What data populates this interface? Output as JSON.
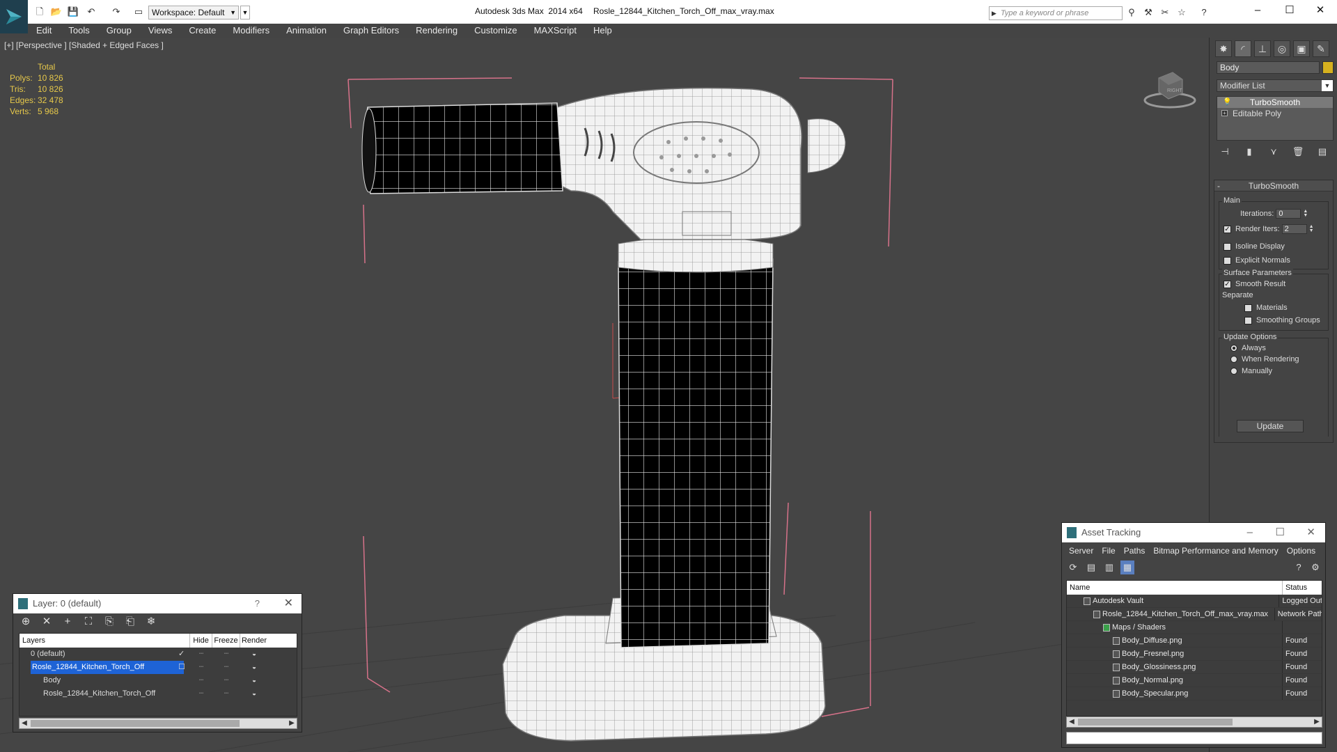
{
  "titlebar": {
    "app_title": "Autodesk 3ds Max  2014 x64",
    "file_title": "Rosle_12844_Kitchen_Torch_Off_max_vray.max",
    "workspace": "Workspace: Default",
    "search_placeholder": "Type a keyword or phrase"
  },
  "menu": [
    "Edit",
    "Tools",
    "Group",
    "Views",
    "Create",
    "Modifiers",
    "Animation",
    "Graph Editors",
    "Rendering",
    "Customize",
    "MAXScript",
    "Help"
  ],
  "viewport": {
    "label": "[+] [Perspective ] [Shaded + Edged Faces ]",
    "stats": {
      "header": "Total",
      "rows": [
        {
          "label": "Polys:",
          "value": "10 826"
        },
        {
          "label": "Tris:",
          "value": "10 826"
        },
        {
          "label": "Edges:",
          "value": "32 478"
        },
        {
          "label": "Verts:",
          "value": "5 968"
        }
      ]
    },
    "viewcube_label": "RIGHT"
  },
  "command_panel": {
    "object_name": "Body",
    "object_color": "#d6b11f",
    "modifier_list": "Modifier List",
    "stack": [
      {
        "label": "TurboSmooth",
        "selected": true
      },
      {
        "label": "Editable Poly",
        "selected": false
      }
    ],
    "rollout_title": "TurboSmooth",
    "main_group": "Main",
    "iterations_label": "Iterations:",
    "iterations_value": "0",
    "render_iters_label": "Render Iters:",
    "render_iters_value": "2",
    "render_iters_checked": true,
    "isoline_label": "Isoline Display",
    "explicit_normals_label": "Explicit Normals",
    "surface_group": "Surface Parameters",
    "smooth_result_label": "Smooth Result",
    "separate_label": "Separate",
    "materials_label": "Materials",
    "smoothing_groups_label": "Smoothing Groups",
    "update_group": "Update Options",
    "always_label": "Always",
    "when_rendering_label": "When Rendering",
    "manually_label": "Manually",
    "update_button": "Update"
  },
  "layer_explorer": {
    "title": "Layer: 0 (default)",
    "help": "?",
    "columns": [
      "Layers",
      "Hide",
      "Freeze",
      "Render"
    ],
    "rows": [
      {
        "name": "0 (default)",
        "indent": 1,
        "selected": false,
        "active": true
      },
      {
        "name": "Rosle_12844_Kitchen_Torch_Off",
        "indent": 1,
        "selected": true,
        "active": false
      },
      {
        "name": "Body",
        "indent": 2,
        "selected": false,
        "active": false
      },
      {
        "name": "Rosle_12844_Kitchen_Torch_Off",
        "indent": 2,
        "selected": false,
        "active": false
      }
    ]
  },
  "asset_tracking": {
    "title": "Asset Tracking",
    "menu": [
      "Server",
      "File",
      "Paths",
      "Bitmap Performance and Memory",
      "Options"
    ],
    "columns": [
      "Name",
      "Status"
    ],
    "rows": [
      {
        "name": "Autodesk Vault",
        "indent": 1,
        "status": "Logged Out"
      },
      {
        "name": "Rosle_12844_Kitchen_Torch_Off_max_vray.max",
        "indent": 2,
        "status": "Network Path"
      },
      {
        "name": "Maps / Shaders",
        "indent": 3,
        "status": ""
      },
      {
        "name": "Body_Diffuse.png",
        "indent": 4,
        "status": "Found"
      },
      {
        "name": "Body_Fresnel.png",
        "indent": 4,
        "status": "Found"
      },
      {
        "name": "Body_Glossiness.png",
        "indent": 4,
        "status": "Found"
      },
      {
        "name": "Body_Normal.png",
        "indent": 4,
        "status": "Found"
      },
      {
        "name": "Body_Specular.png",
        "indent": 4,
        "status": "Found"
      }
    ]
  }
}
